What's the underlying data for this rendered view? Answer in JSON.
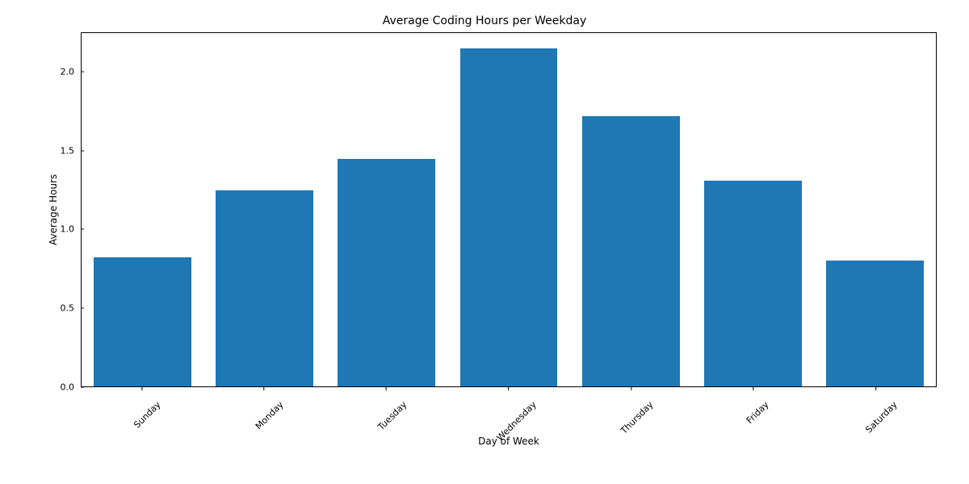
{
  "chart_data": {
    "type": "bar",
    "title": "Average Coding Hours per Weekday",
    "xlabel": "Day of Week",
    "ylabel": "Average Hours",
    "ylim": [
      0,
      2.25
    ],
    "categories": [
      "Sunday",
      "Monday",
      "Tuesday",
      "Wednesday",
      "Thursday",
      "Friday",
      "Saturday"
    ],
    "values": [
      0.82,
      1.25,
      1.45,
      2.15,
      1.72,
      1.31,
      0.8
    ],
    "y_ticks": [
      0.0,
      0.5,
      1.0,
      1.5,
      2.0
    ],
    "y_tick_labels": [
      "0.0",
      "0.5",
      "1.0",
      "1.5",
      "2.0"
    ],
    "bar_color": "#1f77b4"
  }
}
